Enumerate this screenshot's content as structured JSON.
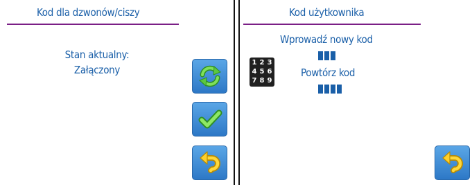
{
  "left_screen": {
    "title": "Kod dla dzwonów/ciszy",
    "status_label": "Stan aktualny:",
    "status_value": "Załączony",
    "buttons": {
      "toggle_icon": "refresh-icon",
      "confirm_icon": "checkmark-icon",
      "back_icon": "back-arrow-icon"
    }
  },
  "right_screen": {
    "title": "Kod użytkownika",
    "new_code_label": "Wprowadź nowy kod",
    "new_code_digits_entered": 3,
    "repeat_code_label": "Powtórz kod",
    "repeat_code_digits_entered": 4,
    "keypad_keys": [
      "1",
      "2",
      "3",
      "4",
      "5",
      "6",
      "7",
      "8",
      "9"
    ],
    "back_icon": "back-arrow-icon"
  },
  "colors": {
    "text": "#1a5fa8",
    "underline": "#7b1f86",
    "button": "#3d8bd8",
    "icon_green": "#4fc03a",
    "icon_yellow": "#f2c21a"
  }
}
